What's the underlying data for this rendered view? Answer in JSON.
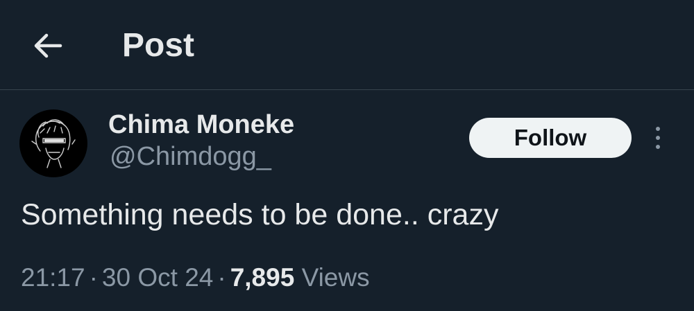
{
  "header": {
    "back_icon": "arrow-left-icon",
    "title": "Post"
  },
  "post": {
    "author": {
      "name": "Chima Moneke",
      "handle": "@Chimdogg_"
    },
    "follow_label": "Follow",
    "more_icon": "more-vertical-icon",
    "text": "Something needs to be done.. crazy",
    "meta": {
      "time": "21:17",
      "separator": "·",
      "date": "30 Oct 24",
      "views_count": "7,895",
      "views_label": "Views"
    }
  },
  "colors": {
    "background": "#15202b",
    "primary_text": "#e7e9ea",
    "secondary_text": "#8b98a5",
    "divider": "#38444d",
    "follow_button_bg": "#eff3f4",
    "follow_button_text": "#0f1419"
  }
}
